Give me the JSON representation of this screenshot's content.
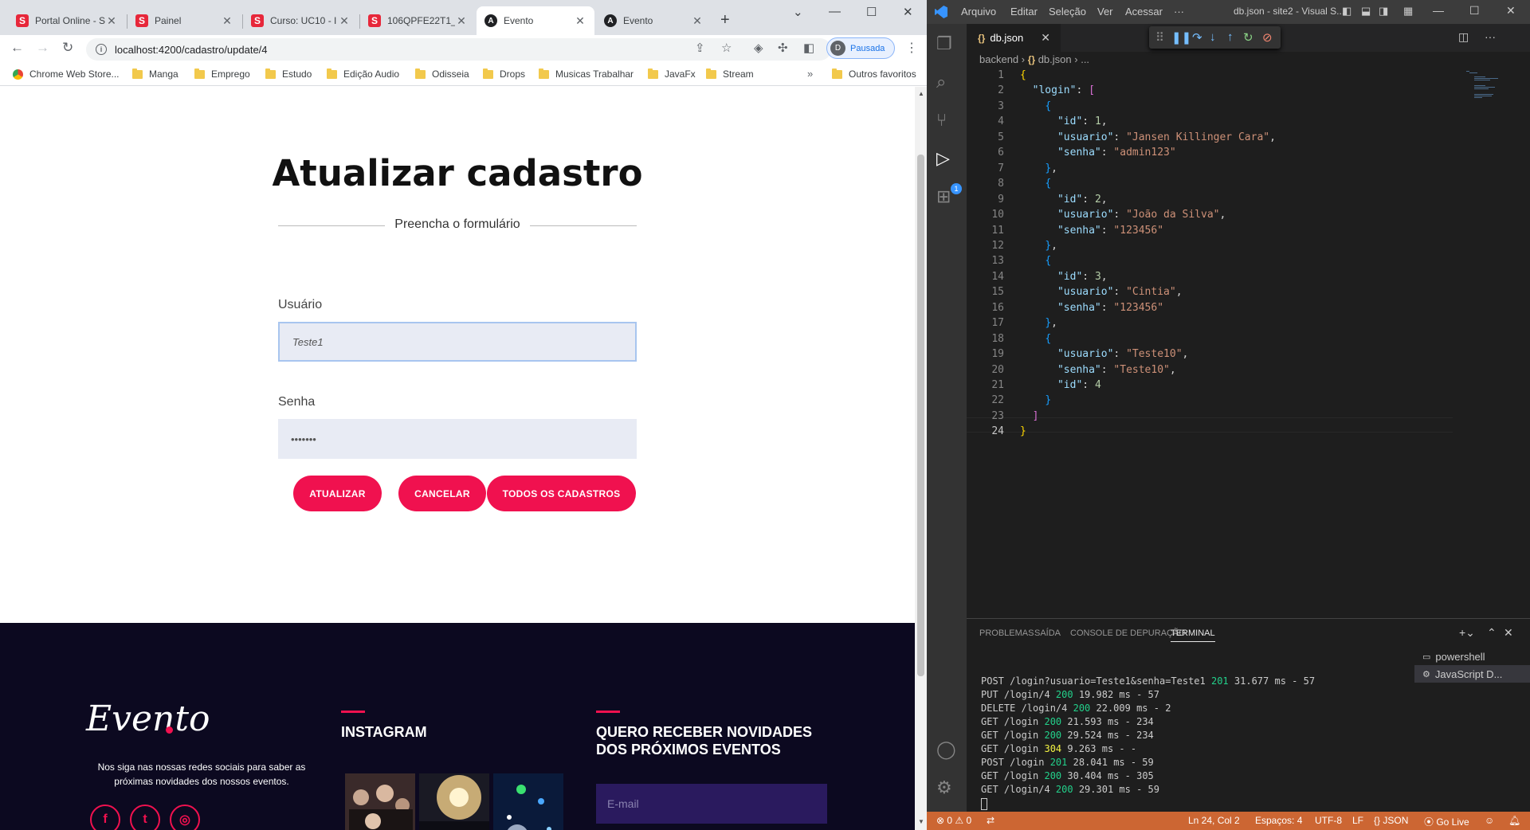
{
  "browser": {
    "tabs": [
      {
        "title": "Portal Online - S",
        "favicon": "S"
      },
      {
        "title": "Painel",
        "favicon": "S"
      },
      {
        "title": "Curso: UC10 - I",
        "favicon": "S"
      },
      {
        "title": "106QPFE22T1_",
        "favicon": "S"
      },
      {
        "title": "Evento",
        "favicon": "A"
      },
      {
        "title": "Evento",
        "favicon": "A"
      }
    ],
    "url": "localhost:4200/cadastro/update/4",
    "profile_label": "Pausada",
    "profile_initial": "D",
    "bookmarks": [
      "Chrome Web Store...",
      "Manga",
      "Emprego",
      "Estudo",
      "Edição Audio",
      "Odisseia",
      "Drops",
      "Musicas Trabalhar",
      "JavaFx",
      "Stream"
    ],
    "other_bookmarks": "Outros favoritos"
  },
  "page": {
    "title": "Atualizar cadastro",
    "subtitle": "Preencha o formulário",
    "user_label": "Usuário",
    "user_value": "Teste1",
    "password_label": "Senha",
    "password_value": "•••••••",
    "buttons": {
      "update": "ATUALIZAR",
      "cancel": "CANCELAR",
      "all": "TODOS OS CADASTROS"
    },
    "footer": {
      "logo": "Evento",
      "follow_text": "Nos siga nas nossas redes sociais para saber as próximas novidades dos nossos eventos.",
      "instagram_heading": "INSTAGRAM",
      "news_heading_1": "QUERO RECEBER NOVIDADES",
      "news_heading_2": "DOS PRÓXIMOS EVENTOS",
      "email_placeholder": "E-mail"
    }
  },
  "vscode": {
    "menu": [
      "Arquivo",
      "Editar",
      "Seleção",
      "Ver",
      "Acessar",
      "···"
    ],
    "window_title": "db.json - site2 - Visual S...",
    "tab": "db.json",
    "breadcrumb": [
      "backend",
      "db.json",
      "..."
    ],
    "code_lines": [
      "{",
      "  \"login\": [",
      "    {",
      "      \"id\": 1,",
      "      \"usuario\": \"Jansen Killinger Cara\",",
      "      \"senha\": \"admin123\"",
      "    },",
      "    {",
      "      \"id\": 2,",
      "      \"usuario\": \"João da Silva\",",
      "      \"senha\": \"123456\"",
      "    },",
      "    {",
      "      \"id\": 3,",
      "      \"usuario\": \"Cintia\",",
      "      \"senha\": \"123456\"",
      "    },",
      "    {",
      "      \"usuario\": \"Teste10\",",
      "      \"senha\": \"Teste10\",",
      "      \"id\": 4",
      "    }",
      "  ]",
      "}"
    ],
    "panel_tabs": [
      "PROBLEMAS",
      "SAÍDA",
      "CONSOLE DE DEPURAÇÃO",
      "TERMINAL"
    ],
    "terminal_lines": [
      {
        "pre": "POST /login?usuario=Teste1&senha=Teste1 ",
        "code": "201",
        "post": " 31.677 ms - 57",
        "color": "green"
      },
      {
        "pre": "PUT /login/4 ",
        "code": "200",
        "post": " 19.982 ms - 57",
        "color": "green"
      },
      {
        "pre": "DELETE /login/4 ",
        "code": "200",
        "post": " 22.009 ms - 2",
        "color": "green"
      },
      {
        "pre": "GET /login ",
        "code": "200",
        "post": " 21.593 ms - 234",
        "color": "green"
      },
      {
        "pre": "GET /login ",
        "code": "200",
        "post": " 29.524 ms - 234",
        "color": "green"
      },
      {
        "pre": "GET /login ",
        "code": "304",
        "post": " 9.263 ms - -",
        "color": "yellow"
      },
      {
        "pre": "POST /login ",
        "code": "201",
        "post": " 28.041 ms - 59",
        "color": "green"
      },
      {
        "pre": "GET /login ",
        "code": "200",
        "post": " 30.404 ms - 305",
        "color": "green"
      },
      {
        "pre": "GET /login/4 ",
        "code": "200",
        "post": " 29.301 ms - 59",
        "color": "green"
      }
    ],
    "terminals": [
      "powershell",
      "JavaScript D..."
    ],
    "debug_badge": "1",
    "status": {
      "errors": "0",
      "warnings": "0",
      "position": "Ln 24, Col 2",
      "spaces": "Espaços: 4",
      "encoding": "UTF-8",
      "eol": "LF",
      "language": "JSON",
      "golive": "Go Live"
    }
  },
  "colors": {
    "accent": "#f0114f",
    "footer_bg": "#0c0920",
    "status_bar": "#cc6633"
  }
}
